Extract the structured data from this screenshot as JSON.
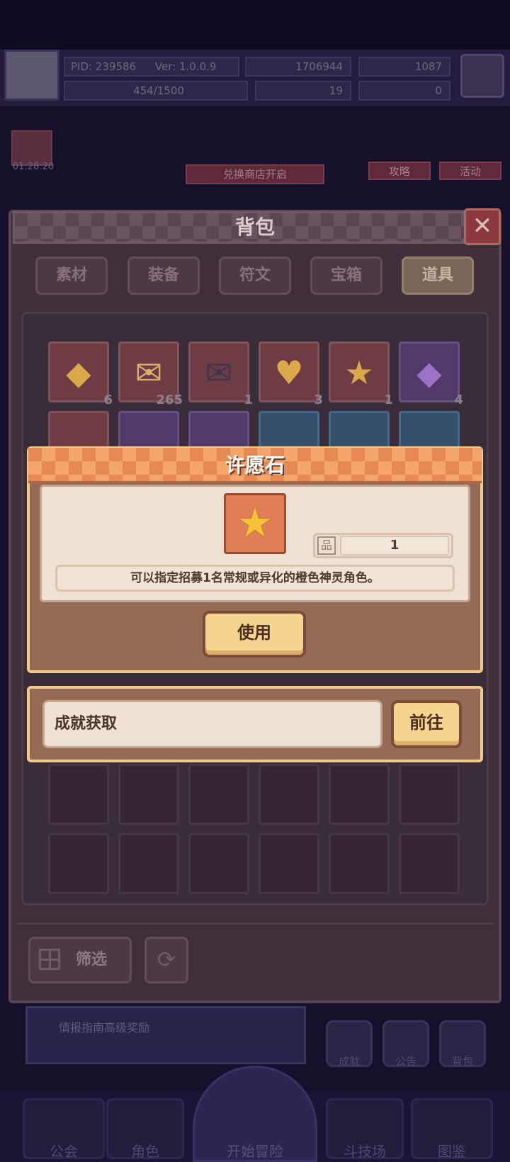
{
  "hud": {
    "pid": "PID: 239586",
    "version": "Ver: 1.0.0.9",
    "gold": "1706944",
    "gems": "1087",
    "energy": "454/1500",
    "tickets": "19",
    "keys": "0",
    "timer": "01:28:20",
    "shop_banner": "兑换商店开启",
    "guide_label": "攻略",
    "event_label": "活动"
  },
  "backpack": {
    "title": "背包",
    "close_symbol": "✕",
    "tabs": [
      {
        "label": "素材"
      },
      {
        "label": "装备"
      },
      {
        "label": "符文"
      },
      {
        "label": "宝箱"
      },
      {
        "label": "道具"
      }
    ],
    "active_tab": "道具",
    "row1": [
      {
        "icon": "yellow-gem-icon",
        "glyph": "◆",
        "count": "6"
      },
      {
        "icon": "letter-pink-icon",
        "glyph": "✉",
        "count": "265"
      },
      {
        "icon": "letter-dark-icon",
        "glyph": "✉",
        "count": "1"
      },
      {
        "icon": "gold-heart-icon",
        "glyph": "♥",
        "count": "3"
      },
      {
        "icon": "wish-star-icon",
        "glyph": "★",
        "count": "1"
      },
      {
        "icon": "purple-gem-icon",
        "glyph": "◆",
        "count": "4"
      }
    ],
    "filter_label": "筛选",
    "refresh_symbol": "⟳"
  },
  "background_ui": {
    "news_text": "情报指南高级奖励",
    "side_labels": [
      "成就",
      "公告",
      "背包"
    ],
    "nav": [
      "公会",
      "角色",
      "开始冒险",
      "斗技场",
      "图鉴"
    ]
  },
  "item_popup": {
    "title": "许愿石",
    "icon": "wish-star-icon",
    "icon_glyph": "★",
    "quantity_icon_glyph": "品",
    "quantity": "1",
    "description": "可以指定招募1名常规或异化的橙色神灵角色。",
    "use_label": "使用"
  },
  "source_popup": {
    "source_text": "成就获取",
    "go_label": "前往"
  },
  "colors": {
    "popup_frame": "#946b57",
    "popup_header": "#e58a54",
    "button_fill": "#f5d48f",
    "panel": "#3e2f3b"
  }
}
